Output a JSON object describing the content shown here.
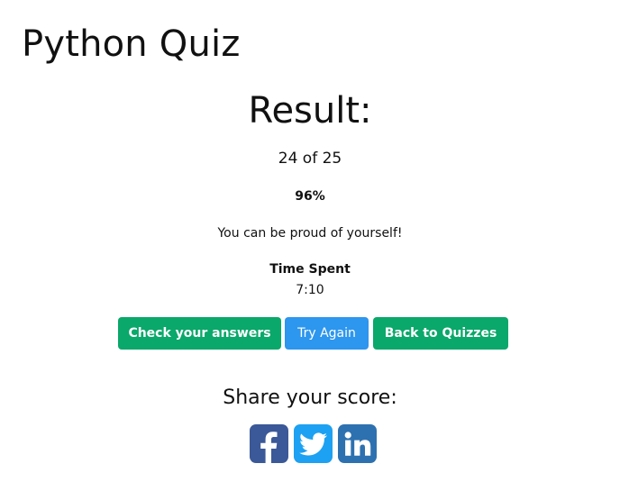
{
  "quiz": {
    "title": "Python Quiz"
  },
  "result": {
    "heading": "Result:",
    "score_text": "24 of 25",
    "correct": 24,
    "total": 25,
    "percent_text": "96%",
    "message": "You can be proud of yourself!",
    "time_label": "Time Spent",
    "time_value": "7:10"
  },
  "actions": {
    "check_label": "Check your answers",
    "retry_label": "Try Again",
    "back_label": "Back to Quizzes"
  },
  "share": {
    "heading": "Share your score:",
    "networks": [
      {
        "name": "facebook",
        "icon": "facebook-icon",
        "color": "#3b5998"
      },
      {
        "name": "twitter",
        "icon": "twitter-icon",
        "color": "#1da1f2"
      },
      {
        "name": "linkedin",
        "icon": "linkedin-icon",
        "color": "#2d71b0"
      }
    ]
  },
  "colors": {
    "primary_green": "#0aa86a",
    "accent_blue": "#2d96ee",
    "text": "#111111",
    "background": "#ffffff"
  }
}
